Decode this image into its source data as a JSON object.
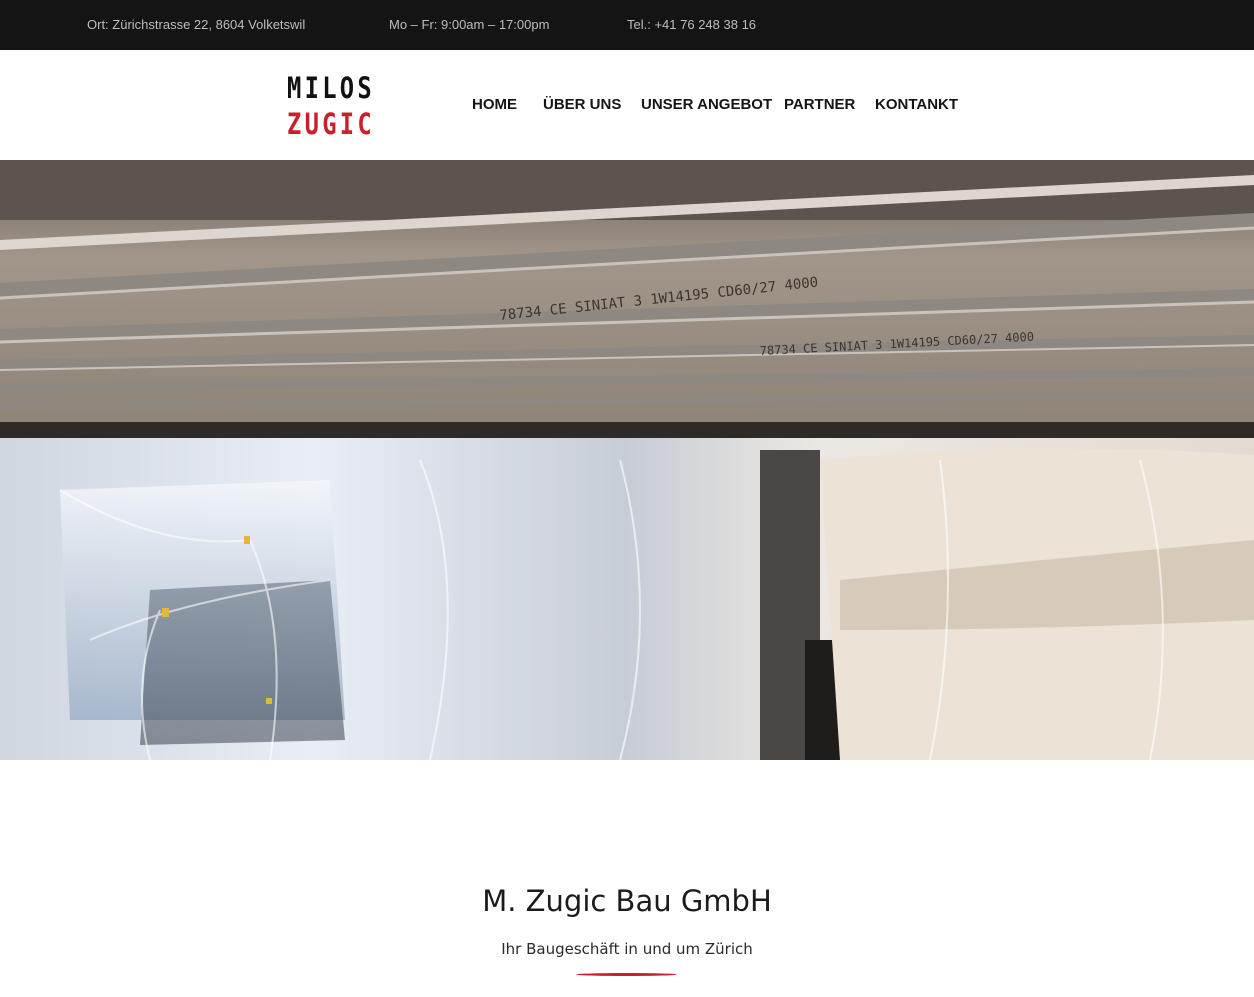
{
  "topbar": {
    "address": "Ort: Zürichstrasse 22, 8604 Volketswil",
    "hours": "Mo – Fr: 9:00am – 17:00pm",
    "phone": "Tel.: +41 76 248 38 16"
  },
  "logo": {
    "line1": "MILOS",
    "line2": "ZUGIC",
    "accent_color": "#c8202a"
  },
  "nav": {
    "items": [
      {
        "label": "HOME"
      },
      {
        "label": "ÜBER UNS"
      },
      {
        "label": "UNSER ANGEBOT"
      },
      {
        "label": "PARTNER"
      },
      {
        "label": "KONTANKT"
      }
    ]
  },
  "hero": {
    "ceiling_profile_text": "78734 CE SINIAT 3 1W14195 CD60/27 4000"
  },
  "intro": {
    "title": "M. Zugic Bau GmbH",
    "subtitle": "Ihr Baugeschäft in und um Zürich"
  }
}
